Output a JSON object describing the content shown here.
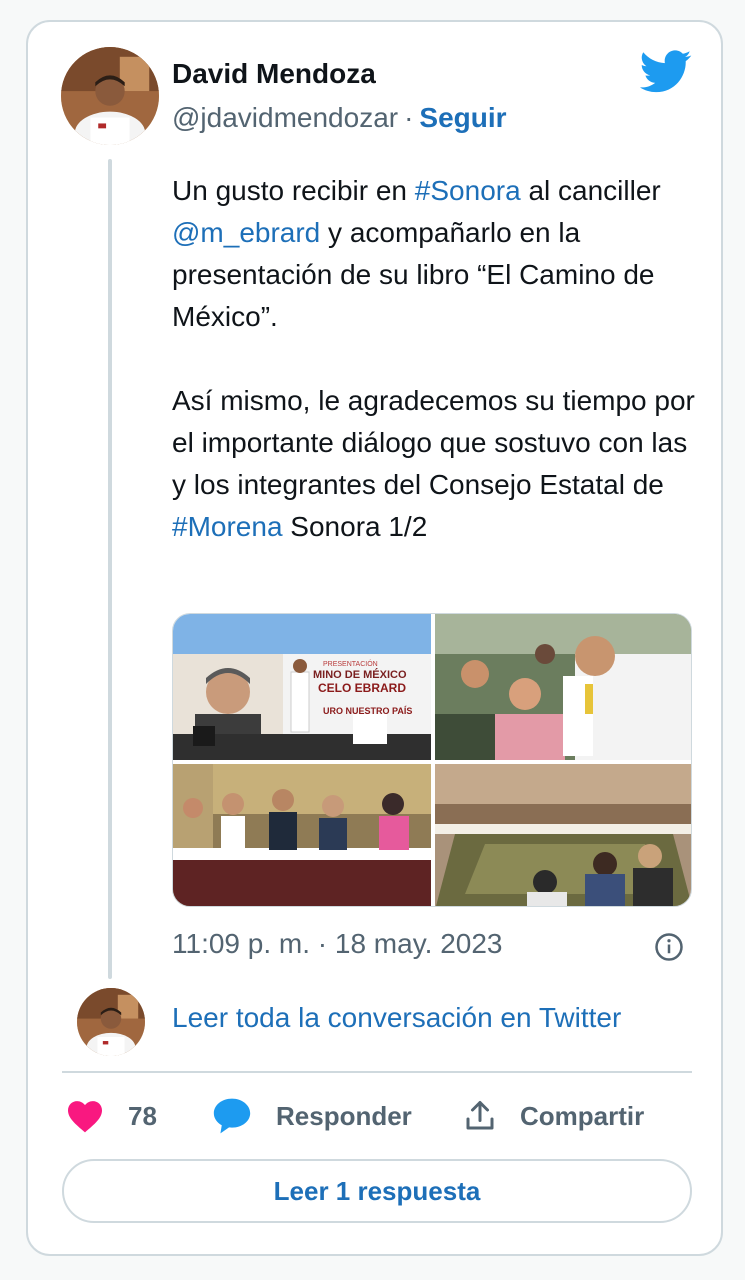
{
  "author": {
    "name": "David Mendoza",
    "handle": "@jdavidmendozar",
    "separator": "·",
    "follow_label": "Seguir"
  },
  "tweet": {
    "p1_a": "Un gusto recibir en ",
    "p1_tag": "#Sonora",
    "p1_b": " al canciller ",
    "p1_mention": "@m_ebrard",
    "p1_c": " y acompañarlo en la presentación de su libro “El Camino de México”.",
    "p2_a": "Así mismo, le agradecemos su tiempo por el importante diálogo que sostuvo con las y los integrantes del Consejo Estatal de ",
    "p2_tag": "#Morena",
    "p2_b": " Sonora 1/2"
  },
  "media": {
    "photos": [
      {
        "icon": "event-stage-photo",
        "banner_line1": "PRESENTACIÓN",
        "banner_line2": "MINO DE MÉXICO",
        "banner_line3": "CELO EBRARD",
        "banner_line4": "URO NUESTRO PAÍS"
      },
      {
        "icon": "crowd-selfie-photo"
      },
      {
        "icon": "meeting-table-photo"
      },
      {
        "icon": "conference-room-photo"
      }
    ]
  },
  "timestamp": "11:09 p. m. · 18 may. 2023",
  "read_conversation": "Leer toda la conversación en Twitter",
  "actions": {
    "like_count": "78",
    "reply_label": "Responder",
    "share_label": "Compartir"
  },
  "read_replies_label": "Leer 1 respuesta",
  "colors": {
    "link": "#1d6fb8",
    "like": "#f91880",
    "twitter_blue": "#1d9bf0",
    "muted": "#536471",
    "border": "#cfd9de"
  }
}
